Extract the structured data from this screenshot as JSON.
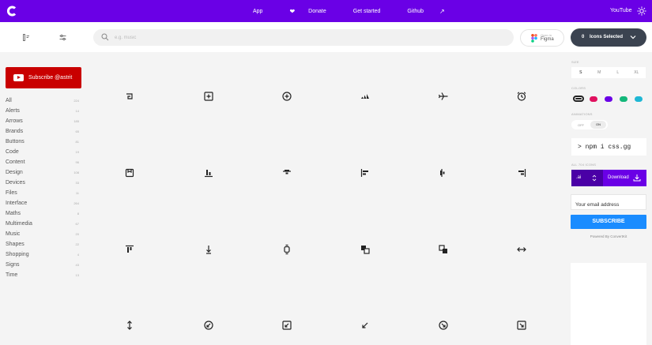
{
  "topbar": {
    "logo_icon": "css-gg-logo",
    "nav": [
      {
        "label": "App",
        "active": true
      },
      {
        "label": "Donate",
        "icon": "heart-icon"
      },
      {
        "label": "Get started"
      },
      {
        "label": "Github",
        "icon": "arrow-top-right-icon"
      }
    ],
    "youtube": "YouTube",
    "theme_icon": "sun-icon"
  },
  "toolbar": {
    "search_placeholder": "e.g. music",
    "figma_small": "Open in",
    "figma_name": "Figma",
    "selected_count": "0",
    "selected_label": "Icons Selected"
  },
  "sidebar": {
    "subscribe_label": "Subscribe @astrit",
    "categories": [
      {
        "name": "All",
        "count": "224"
      },
      {
        "name": "Alerts",
        "count": "14"
      },
      {
        "name": "Arrows",
        "count": "185"
      },
      {
        "name": "Brands",
        "count": "65"
      },
      {
        "name": "Buttons",
        "count": "81"
      },
      {
        "name": "Code",
        "count": "19"
      },
      {
        "name": "Content",
        "count": "96"
      },
      {
        "name": "Design",
        "count": "108"
      },
      {
        "name": "Devices",
        "count": "33"
      },
      {
        "name": "Files",
        "count": "11"
      },
      {
        "name": "Interface",
        "count": "264"
      },
      {
        "name": "Maths",
        "count": "8"
      },
      {
        "name": "Multimedia",
        "count": "67"
      },
      {
        "name": "Music",
        "count": "20"
      },
      {
        "name": "Shapes",
        "count": "22"
      },
      {
        "name": "Shopping",
        "count": "4"
      },
      {
        "name": "Signs",
        "count": "43"
      },
      {
        "name": "Time",
        "count": "13"
      }
    ]
  },
  "grid": {
    "icons": [
      "abstract-icon",
      "add-r-icon",
      "add-icon",
      "adidas-icon",
      "airplane-icon",
      "alarm-icon",
      "album-icon",
      "align-bottom-icon",
      "align-center-icon",
      "align-left-icon",
      "align-middle-icon",
      "align-right-icon",
      "align-top-icon",
      "arrow-align-v-icon",
      "apple-watch-icon",
      "arrange-back-icon",
      "arrange-front-icon",
      "arrows-h-icon",
      "arrows-v-icon",
      "arrow-bottom-left-o-icon",
      "arrow-bottom-left-r-icon",
      "arrow-bottom-left-icon",
      "arrow-bottom-right-o-icon",
      "arrow-bottom-right-r-icon"
    ]
  },
  "panel": {
    "size_label": "SIZE",
    "sizes": [
      "S",
      "M",
      "L",
      "XL"
    ],
    "colors_label": "COLORS",
    "colors": [
      "#222222",
      "#e0115f",
      "#6a00e6",
      "#13b77a",
      "#1fb7d4"
    ],
    "animations_label": "ANIMATIONS",
    "anim_off": "OFF",
    "anim_on": "ON",
    "npm": "> npm i css.gg",
    "all_icons_label": "ALL 704 ICONS",
    "format": ".ai",
    "download": "Download",
    "email_placeholder": "Your email address",
    "subscribe": "SUBSCRIBE",
    "powered": "Powered By ConvertKit"
  }
}
